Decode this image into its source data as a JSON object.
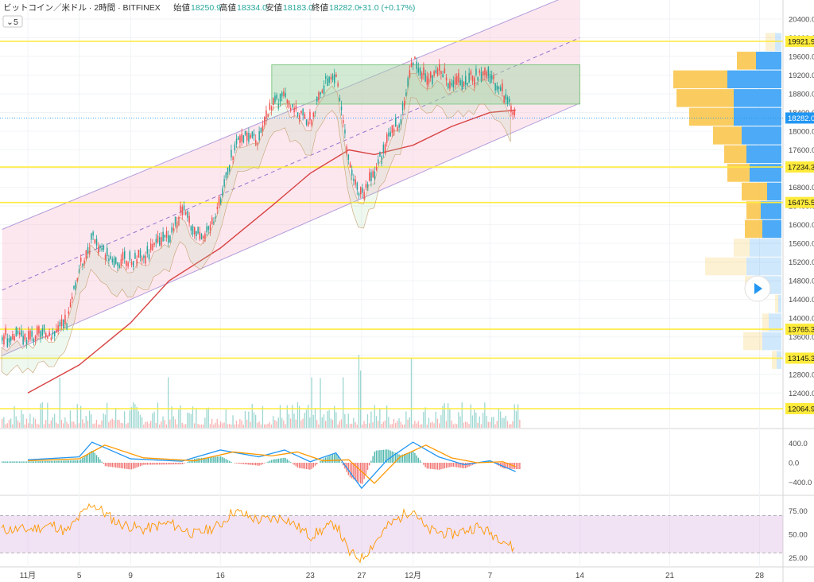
{
  "header": {
    "symbol": "ビットコイン／米ドル · 2時間 · BITFINEX",
    "open_label": "始値",
    "open": "18250.9",
    "high_label": "高値",
    "high": "18334.0",
    "low_label": "安値",
    "low": "18183.0",
    "close_label": "終値",
    "close": "18282.0",
    "change": "+31.0 (+0.17%)",
    "indicator_count": "5"
  },
  "colors": {
    "up": "#26a69a",
    "down": "#ef5350",
    "level": "#ffeb3b",
    "price_tag": "#2196f3",
    "ma": "#d84343",
    "channel": "#b39ddb",
    "box": "#81c784",
    "vp_buy": "#f9c74f",
    "vp_sell": "#42a5f5",
    "macd": "#2196f3",
    "signal": "#ff9800",
    "rsi": "#ff9800"
  },
  "chart_data": [
    {
      "type": "candlestick",
      "title": "ビットコイン／米ドル · 2時間 · BITFINEX",
      "ylim": [
        12000,
        20600
      ],
      "y_ticks": [
        "20400.0",
        "20000.0",
        "19600.0",
        "19200.0",
        "18800.0",
        "18400.0",
        "18000.0",
        "17600.0",
        "17200.0",
        "16800.0",
        "16400.0",
        "16000.0",
        "15600.0",
        "15200.0",
        "14800.0",
        "14400.0",
        "14000.0",
        "13600.0",
        "13200.0",
        "12800.0",
        "12400.0"
      ],
      "x_ticks": [
        "11月",
        "5",
        "9",
        "16",
        "23",
        "27",
        "12月",
        "7",
        "14",
        "21",
        "28"
      ],
      "price_path": [
        {
          "x": "Nov 1",
          "y": 13600
        },
        {
          "x": "Nov 3",
          "y": 13700
        },
        {
          "x": "Nov 4",
          "y": 13900
        },
        {
          "x": "Nov 5",
          "y": 15100
        },
        {
          "x": "Nov 6",
          "y": 15700
        },
        {
          "x": "Nov 7",
          "y": 15400
        },
        {
          "x": "Nov 8",
          "y": 15200
        },
        {
          "x": "Nov 10",
          "y": 15300
        },
        {
          "x": "Nov 12",
          "y": 15800
        },
        {
          "x": "Nov 13",
          "y": 16300
        },
        {
          "x": "Nov 14",
          "y": 15900
        },
        {
          "x": "Nov 15",
          "y": 15800
        },
        {
          "x": "Nov 16",
          "y": 16600
        },
        {
          "x": "Nov 17",
          "y": 17600
        },
        {
          "x": "Nov 18",
          "y": 18000
        },
        {
          "x": "Nov 19",
          "y": 17800
        },
        {
          "x": "Nov 20",
          "y": 18600
        },
        {
          "x": "Nov 21",
          "y": 18700
        },
        {
          "x": "Nov 22",
          "y": 18400
        },
        {
          "x": "Nov 23",
          "y": 18200
        },
        {
          "x": "Nov 24",
          "y": 19000
        },
        {
          "x": "Nov 25",
          "y": 19200
        },
        {
          "x": "Nov 26",
          "y": 17200
        },
        {
          "x": "Nov 27",
          "y": 16600
        },
        {
          "x": "Nov 28",
          "y": 17200
        },
        {
          "x": "Nov 29",
          "y": 17800
        },
        {
          "x": "Nov 30",
          "y": 18300
        },
        {
          "x": "Dec 1",
          "y": 19600
        },
        {
          "x": "Dec 2",
          "y": 19100
        },
        {
          "x": "Dec 3",
          "y": 19300
        },
        {
          "x": "Dec 4",
          "y": 19000
        },
        {
          "x": "Dec 5",
          "y": 19100
        },
        {
          "x": "Dec 6",
          "y": 19200
        },
        {
          "x": "Dec 7",
          "y": 19200
        },
        {
          "x": "Dec 8",
          "y": 18800
        },
        {
          "x": "Dec 9",
          "y": 18282
        }
      ],
      "moving_average": [
        {
          "x": "Nov 1",
          "y": 12400
        },
        {
          "x": "Nov 5",
          "y": 13000
        },
        {
          "x": "Nov 9",
          "y": 13900
        },
        {
          "x": "Nov 12",
          "y": 14800
        },
        {
          "x": "Nov 16",
          "y": 15500
        },
        {
          "x": "Nov 20",
          "y": 16400
        },
        {
          "x": "Nov 23",
          "y": 17100
        },
        {
          "x": "Nov 26",
          "y": 17600
        },
        {
          "x": "Nov 28",
          "y": 17500
        },
        {
          "x": "Dec 1",
          "y": 17700
        },
        {
          "x": "Dec 4",
          "y": 18100
        },
        {
          "x": "Dec 7",
          "y": 18400
        },
        {
          "x": "Dec 9",
          "y": 18450
        }
      ],
      "channel": {
        "upper": [
          {
            "x": "Oct 30",
            "y": 15900
          },
          {
            "x": "Dec 14",
            "y": 21000
          }
        ],
        "mid": [
          {
            "x": "Oct 30",
            "y": 14600
          },
          {
            "x": "Dec 14",
            "y": 20000
          }
        ],
        "lower": [
          {
            "x": "Oct 30",
            "y": 13200
          },
          {
            "x": "Dec 14",
            "y": 18600
          }
        ]
      },
      "zone": {
        "from": "Nov 20",
        "to": "Dec 14",
        "high": 19420,
        "low": 18580
      },
      "levels": [
        {
          "value": 19921.9,
          "label": "19921.9"
        },
        {
          "value": 17234.3,
          "label": "17234.3"
        },
        {
          "value": 16475.5,
          "label": "16475.5"
        },
        {
          "value": 13765.3,
          "label": "13765.3"
        },
        {
          "value": 13145.3,
          "label": "13145.3"
        },
        {
          "value": 12064.9,
          "label": "12064.9"
        }
      ],
      "last_price": {
        "value": 18282.0,
        "label": "18282.0"
      },
      "volume_profile": [
        {
          "price": 19900,
          "buy": 0.06,
          "sell": 0.04
        },
        {
          "price": 19500,
          "buy": 0.12,
          "sell": 0.16
        },
        {
          "price": 19100,
          "buy": 0.34,
          "sell": 0.34
        },
        {
          "price": 18700,
          "buy": 0.36,
          "sell": 0.3
        },
        {
          "price": 18300,
          "buy": 0.28,
          "sell": 0.3
        },
        {
          "price": 17900,
          "buy": 0.18,
          "sell": 0.25
        },
        {
          "price": 17500,
          "buy": 0.14,
          "sell": 0.22
        },
        {
          "price": 17100,
          "buy": 0.14,
          "sell": 0.2
        },
        {
          "price": 16700,
          "buy": 0.16,
          "sell": 0.09
        },
        {
          "price": 16300,
          "buy": 0.09,
          "sell": 0.13
        },
        {
          "price": 15900,
          "buy": 0.11,
          "sell": 0.12
        },
        {
          "price": 15500,
          "buy": 0.1,
          "sell": 0.2
        },
        {
          "price": 15100,
          "buy": 0.26,
          "sell": 0.22
        },
        {
          "price": 14700,
          "buy": 0.05,
          "sell": 0.18
        },
        {
          "price": 14300,
          "buy": 0.02,
          "sell": 0.02
        },
        {
          "price": 13900,
          "buy": 0.04,
          "sell": 0.08
        },
        {
          "price": 13500,
          "buy": 0.12,
          "sell": 0.12
        },
        {
          "price": 13100,
          "buy": 0.03,
          "sell": 0.03
        }
      ]
    },
    {
      "type": "line",
      "ylim": [
        -600,
        600
      ],
      "y_ticks": [
        "400.0",
        "0.0",
        "−400.0"
      ],
      "series": [
        {
          "values": [
            {
              "x": "Nov 1",
              "y": 60
            },
            {
              "x": "Nov 5",
              "y": 120
            },
            {
              "x": "Nov 6",
              "y": 420
            },
            {
              "x": "Nov 9",
              "y": 80
            },
            {
              "x": "Nov 13",
              "y": 30
            },
            {
              "x": "Nov 16",
              "y": 260
            },
            {
              "x": "Nov 19",
              "y": 120
            },
            {
              "x": "Nov 21",
              "y": 260
            },
            {
              "x": "Nov 23",
              "y": 20
            },
            {
              "x": "Nov 25",
              "y": 200
            },
            {
              "x": "Nov 27",
              "y": -520
            },
            {
              "x": "Nov 29",
              "y": 60
            },
            {
              "x": "Dec 1",
              "y": 420
            },
            {
              "x": "Dec 3",
              "y": 120
            },
            {
              "x": "Dec 5",
              "y": -40
            },
            {
              "x": "Dec 7",
              "y": 40
            },
            {
              "x": "Dec 9",
              "y": -180
            }
          ]
        },
        {
          "values": [
            {
              "x": "Nov 1",
              "y": 40
            },
            {
              "x": "Nov 5",
              "y": 80
            },
            {
              "x": "Nov 7",
              "y": 360
            },
            {
              "x": "Nov 10",
              "y": 100
            },
            {
              "x": "Nov 14",
              "y": 40
            },
            {
              "x": "Nov 17",
              "y": 220
            },
            {
              "x": "Nov 20",
              "y": 140
            },
            {
              "x": "Nov 22",
              "y": 220
            },
            {
              "x": "Nov 24",
              "y": 40
            },
            {
              "x": "Nov 26",
              "y": 60
            },
            {
              "x": "Nov 28",
              "y": -420
            },
            {
              "x": "Nov 30",
              "y": 120
            },
            {
              "x": "Dec 2",
              "y": 360
            },
            {
              "x": "Dec 4",
              "y": 100
            },
            {
              "x": "Dec 6",
              "y": 0
            },
            {
              "x": "Dec 8",
              "y": 20
            },
            {
              "x": "Dec 9",
              "y": -80
            }
          ]
        }
      ]
    },
    {
      "type": "line",
      "ylim": [
        15,
        90
      ],
      "y_ticks": [
        "75.00",
        "50.00",
        "25.00"
      ],
      "series": [
        {
          "values": [
            {
              "x": "Nov 1",
              "y": 55
            },
            {
              "x": "Nov 3",
              "y": 60
            },
            {
              "x": "Nov 4",
              "y": 52
            },
            {
              "x": "Nov 5",
              "y": 68
            },
            {
              "x": "Nov 6",
              "y": 83
            },
            {
              "x": "Nov 8",
              "y": 62
            },
            {
              "x": "Nov 10",
              "y": 55
            },
            {
              "x": "Nov 12",
              "y": 62
            },
            {
              "x": "Nov 14",
              "y": 50
            },
            {
              "x": "Nov 16",
              "y": 60
            },
            {
              "x": "Nov 17",
              "y": 75
            },
            {
              "x": "Nov 19",
              "y": 65
            },
            {
              "x": "Nov 21",
              "y": 68
            },
            {
              "x": "Nov 23",
              "y": 48
            },
            {
              "x": "Nov 25",
              "y": 62
            },
            {
              "x": "Nov 26",
              "y": 30
            },
            {
              "x": "Nov 27",
              "y": 24
            },
            {
              "x": "Nov 29",
              "y": 58
            },
            {
              "x": "Dec 1",
              "y": 78
            },
            {
              "x": "Dec 2",
              "y": 55
            },
            {
              "x": "Dec 4",
              "y": 50
            },
            {
              "x": "Dec 6",
              "y": 58
            },
            {
              "x": "Dec 8",
              "y": 45
            },
            {
              "x": "Dec 9",
              "y": 32
            }
          ]
        }
      ]
    }
  ]
}
